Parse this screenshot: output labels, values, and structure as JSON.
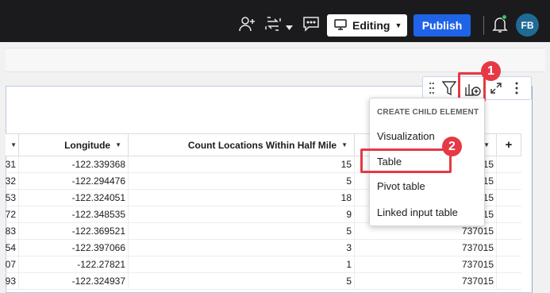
{
  "topbar": {
    "editing_label": "Editing",
    "publish_label": "Publish",
    "avatar_initials": "FB",
    "icons": [
      "add-person-icon",
      "swap-icon",
      "chevron-down-icon",
      "comment-icon",
      "monitor-icon",
      "bell-icon"
    ]
  },
  "element_toolbar": {
    "icons": [
      "drag-handle-icon",
      "filter-icon",
      "add-child-element-icon",
      "expand-icon",
      "more-options-icon"
    ]
  },
  "table": {
    "columns": [
      {
        "label": ""
      },
      {
        "label": "Longitude"
      },
      {
        "label": "Count Locations Within Half Mile"
      },
      {
        "label": ""
      },
      {
        "label": "+"
      }
    ],
    "rows": [
      {
        "c0": "31",
        "c1": "-122.339368",
        "c2": "15",
        "c3": "737015"
      },
      {
        "c0": "32",
        "c1": "-122.294476",
        "c2": "5",
        "c3": "737015"
      },
      {
        "c0": "53",
        "c1": "-122.324051",
        "c2": "18",
        "c3": "737015"
      },
      {
        "c0": "72",
        "c1": "-122.348535",
        "c2": "9",
        "c3": "737015"
      },
      {
        "c0": "83",
        "c1": "-122.369521",
        "c2": "5",
        "c3": "737015"
      },
      {
        "c0": "54",
        "c1": "-122.397066",
        "c2": "3",
        "c3": "737015"
      },
      {
        "c0": "07",
        "c1": "-122.27821",
        "c2": "1",
        "c3": "737015"
      },
      {
        "c0": "93",
        "c1": "-122.324937",
        "c2": "5",
        "c3": "737015"
      }
    ]
  },
  "menu": {
    "header": "CREATE CHILD ELEMENT",
    "items": [
      "Visualization",
      "Table",
      "Pivot table",
      "Linked input table"
    ]
  },
  "callouts": [
    "1",
    "2"
  ],
  "colors": {
    "accent": "#1f63e8",
    "highlight": "#e53945",
    "topbar": "#1b1b1d"
  }
}
